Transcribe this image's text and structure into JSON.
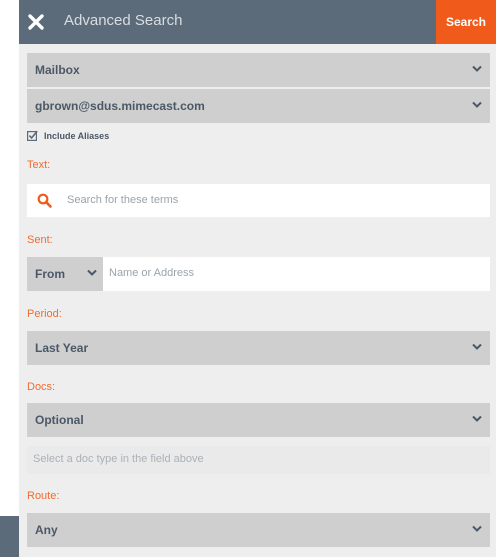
{
  "header": {
    "title": "Advanced Search",
    "search_label": "Search"
  },
  "mailbox": {
    "value": "Mailbox"
  },
  "account": {
    "value": "gbrown@sdus.mimecast.com"
  },
  "include_aliases": {
    "label": "Include Aliases",
    "checked": true
  },
  "text": {
    "label": "Text:",
    "placeholder": "Search for these terms"
  },
  "sent": {
    "label": "Sent:",
    "direction": "From",
    "address_placeholder": "Name or Address"
  },
  "period": {
    "label": "Period:",
    "value": "Last Year"
  },
  "docs": {
    "label": "Docs:",
    "value": "Optional",
    "helper": "Select a doc type in the field above"
  },
  "route": {
    "label": "Route:",
    "value": "Any"
  },
  "colors": {
    "header": "#5b6b79",
    "accent": "#f05a1a",
    "field": "#cfcfcf",
    "background": "#eeeeee"
  },
  "icons": {
    "close": "close-icon",
    "chevron": "chevron-down-icon",
    "search": "search-icon",
    "checkbox": "checkbox-checked-icon"
  }
}
